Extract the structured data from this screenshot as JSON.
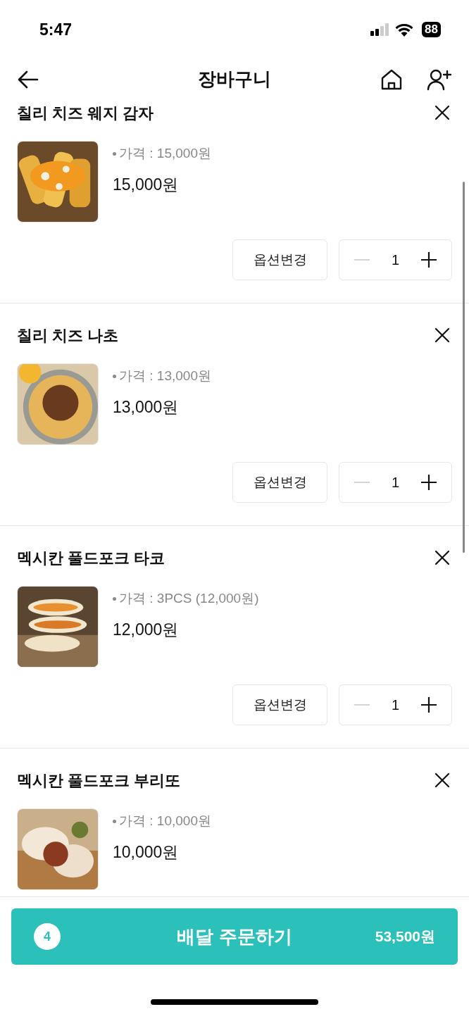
{
  "status_bar": {
    "time": "5:47",
    "battery": "88"
  },
  "header": {
    "title": "장바구니"
  },
  "items": [
    {
      "name": "칠리 치즈 웨지 감자",
      "option": "가격 : 15,000원",
      "price": "15,000원",
      "option_button": "옵션변경",
      "quantity": "1",
      "decrease_disabled": true
    },
    {
      "name": "칠리 치즈 나초",
      "option": "가격 : 13,000원",
      "price": "13,000원",
      "option_button": "옵션변경",
      "quantity": "1",
      "decrease_disabled": true
    },
    {
      "name": "멕시칸 풀드포크 타코",
      "option": "가격 : 3PCS (12,000원)",
      "price": "12,000원",
      "option_button": "옵션변경",
      "quantity": "1",
      "decrease_disabled": true
    },
    {
      "name": "멕시칸 풀드포크 부리또",
      "option": "가격 : 10,000원",
      "price": "10,000원"
    }
  ],
  "order_button": {
    "count": "4",
    "label": "배달 주문하기",
    "total": "53,500원"
  }
}
